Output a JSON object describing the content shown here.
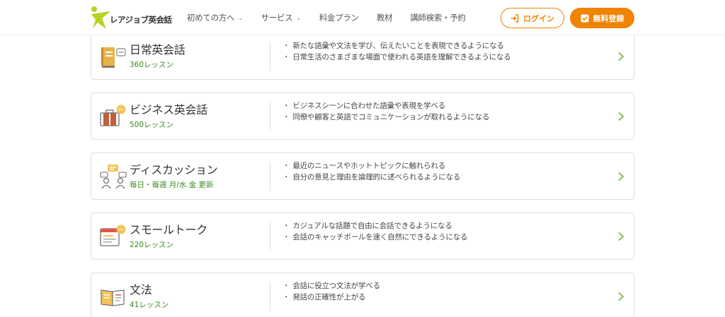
{
  "header": {
    "logo_text": "レアジョブ英会話",
    "nav": [
      {
        "label": "初めての方へ",
        "has_dropdown": true
      },
      {
        "label": "サービス",
        "has_dropdown": true
      },
      {
        "label": "料金プラン",
        "has_dropdown": false
      },
      {
        "label": "教材",
        "has_dropdown": false
      },
      {
        "label": "講師検索・予約",
        "has_dropdown": false
      }
    ],
    "login_label": "ログイン",
    "register_label": "無料登録"
  },
  "colors": {
    "accent": "#f08300",
    "green": "#3a8a1f",
    "arrow": "#7cb342"
  },
  "courses": [
    {
      "icon": "book-chat-icon",
      "title": "日常英会話",
      "subtitle": "360レッスン",
      "bullets": [
        "新たな語彙や文法を学び、伝えたいことを表現できるようになる",
        "日常生活のさまざまな場面で使われる英語を理解できるようになる"
      ]
    },
    {
      "icon": "briefcase-chat-icon",
      "title": "ビジネス英会話",
      "subtitle": "500レッスン",
      "bullets": [
        "ビジネスシーンに合わせた語彙や表現を学べる",
        "同僚や顧客と英語でコミュニケーションが取れるようになる"
      ]
    },
    {
      "icon": "people-discussion-icon",
      "title": "ディスカッション",
      "subtitle": "毎日・毎週 月/水.金 更新",
      "bullets": [
        "最近のニュースやホットトピックに触れられる",
        "自分の意見と理由を論理的に述べられるようになる"
      ]
    },
    {
      "icon": "browser-chat-icon",
      "title": "スモールトーク",
      "subtitle": "220レッスン",
      "bullets": [
        "カジュアルな話題で自由に会話できるようになる",
        "会話のキャッチボールを速く自然にできるようになる"
      ]
    },
    {
      "icon": "open-book-icon",
      "title": "文法",
      "subtitle": "41レッスン",
      "bullets": [
        "会話に役立つ文法が学べる",
        "発話の正確性が上がる"
      ]
    }
  ]
}
